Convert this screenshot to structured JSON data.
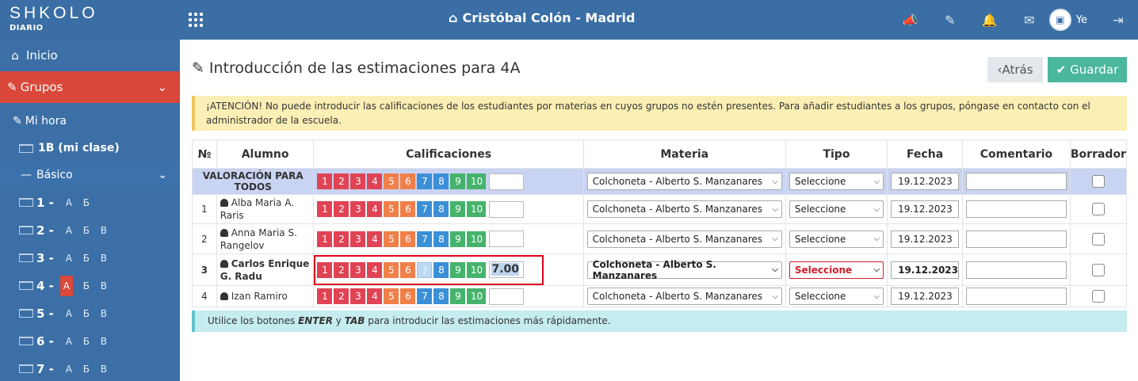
{
  "header": {
    "logo_main": "SHKOLO",
    "logo_sub": "DIARIO",
    "school": "Cristóbal Colón - Madrid",
    "user_initials": "Ye"
  },
  "sidebar": {
    "inicio": "Inicio",
    "grupos": "Grupos",
    "mi_hora": "Mi hora",
    "mi_clase": "1B (mi clase)",
    "basico": "Básico",
    "grades": [
      {
        "num": "1 -",
        "sections": [
          "А",
          "Б"
        ]
      },
      {
        "num": "2 -",
        "sections": [
          "А",
          "Б",
          "В"
        ]
      },
      {
        "num": "3 -",
        "sections": [
          "А",
          "Б",
          "В"
        ]
      },
      {
        "num": "4 -",
        "sections": [
          "А",
          "Б",
          "В"
        ],
        "active_index": 0
      },
      {
        "num": "5 -",
        "sections": [
          "А",
          "Б",
          "В"
        ]
      },
      {
        "num": "6 -",
        "sections": [
          "А",
          "Б",
          "В"
        ]
      },
      {
        "num": "7 -",
        "sections": [
          "А",
          "Б",
          "В"
        ]
      }
    ]
  },
  "page": {
    "title": "Introducción de las estimaciones para 4A",
    "back_label": "Atrás",
    "save_label": "Guardar",
    "warning": "¡ATENCIÓN! No puede introducir las calificaciones de los estudiantes por materias en cuyos grupos no estén presentes. Para añadir estudiantes a los grupos, póngase en contacto con el administrador de la escuela.",
    "info_pre": "Utilice los botones ",
    "info_enter": "ENTER",
    "info_mid": " y ",
    "info_tab": "TAB",
    "info_post": " para introducir las estimaciones más rápidamente."
  },
  "table": {
    "headers": {
      "num": "№",
      "alumno": "Alumno",
      "calificaciones": "Calificaciones",
      "materia": "Materia",
      "tipo": "Tipo",
      "fecha": "Fecha",
      "comentario": "Comentario",
      "borrador": "Borrador"
    },
    "grade_buttons": [
      "1",
      "2",
      "3",
      "4",
      "5",
      "6",
      "7",
      "8",
      "9",
      "10"
    ],
    "all_row_label": "VALORACIÓN PARA TODOS",
    "materia_value": "Colchoneta - Alberto S. Manzanares",
    "tipo_value": "Seleccione",
    "fecha_value": "19.12.2023",
    "rows": [
      {
        "num": "1",
        "name": "Alba Maria A. Raris",
        "grade": ""
      },
      {
        "num": "2",
        "name": "Anna Maria S. Rangelov",
        "grade": ""
      },
      {
        "num": "3",
        "name": "Carlos Enrique G. Radu",
        "grade": "7.00"
      },
      {
        "num": "4",
        "name": "Izan Ramiro",
        "grade": ""
      }
    ]
  },
  "colors": {
    "topbar": "#3a6ea5",
    "grupos_active": "#d9483b",
    "grade_red": "#e04354",
    "grade_orange": "#f07f49",
    "grade_blue": "#3b8fd6",
    "grade_green": "#46b36c",
    "save_button": "#4bb79d",
    "focus_outline": "#e2001a"
  }
}
